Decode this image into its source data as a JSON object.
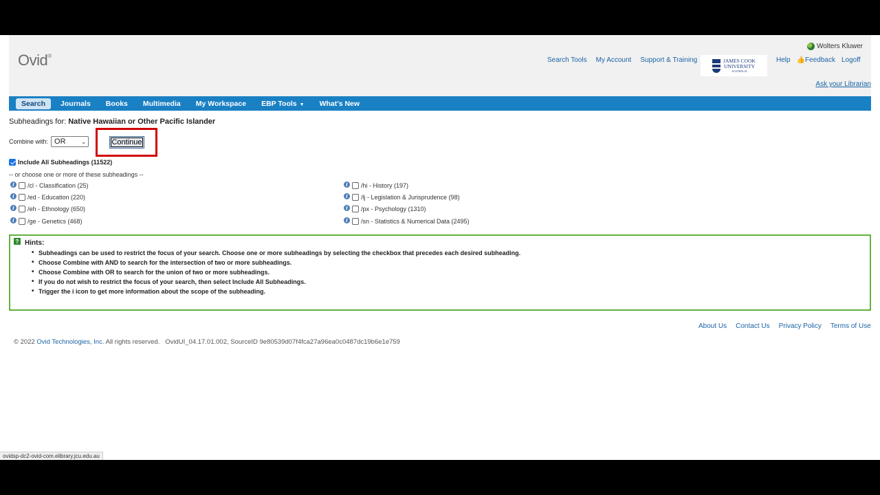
{
  "header": {
    "logo": "Ovid",
    "logo_mark": "®",
    "brand": "Wolters Kluwer",
    "top_links": [
      "Search Tools",
      "My Account",
      "Support & Training"
    ],
    "institution": {
      "line1": "JAMES COOK",
      "line2": "UNIVERSITY",
      "line3": "AUSTRALIA"
    },
    "right_links": [
      "Help",
      "Feedback",
      "Logoff"
    ],
    "ask_librarian": "Ask your Librarian"
  },
  "nav": {
    "tabs": [
      "Search",
      "Journals",
      "Books",
      "Multimedia",
      "My Workspace",
      "EBP Tools",
      "What's New"
    ],
    "active": "Search"
  },
  "subheadings": {
    "title_prefix": "Subheadings for:",
    "title_term": "Native Hawaiian or Other Pacific Islander",
    "combine_label": "Combine with:",
    "combine_value": "OR",
    "continue_label": "Continue",
    "include_all_label": "Include All Subheadings (11522)",
    "or_choose": "-- or choose one or more of these subheadings --",
    "left": [
      "/cl - Classification (25)",
      "/ed - Education (220)",
      "/eh - Ethnology (650)",
      "/ge - Genetics (468)"
    ],
    "right": [
      "/hi - History (197)",
      "/lj - Legislation & Jurisprudence (98)",
      "/px - Psychology (1310)",
      "/sn - Statistics & Numerical Data (2495)"
    ]
  },
  "hints": {
    "title": "Hints",
    "items": [
      "Subheadings can be used to restrict the focus of your search. Choose one or more subheadings by selecting the checkbox that precedes each desired subheading.",
      "Choose Combine with AND to search for the intersection of two or more subheadings.",
      "Choose Combine with OR to search for the union of two or more subheadings.",
      "If you do not wish to restrict the focus of your search, then select Include All Subheadings.",
      "Trigger the i icon to get more information about the scope of the subheading."
    ]
  },
  "footer": {
    "links": [
      "About Us",
      "Contact Us",
      "Privacy Policy",
      "Terms of Use"
    ],
    "copyright_prefix": "© 2022",
    "copyright_company": "Ovid Technologies, Inc.",
    "copyright_suffix": "All rights reserved.   OvidUI_04.17.01.002, SourceID 9e80539d07f4fca27a96ea0c0487dc19b6e1e759"
  },
  "status_url": "ovidsp-dc2-ovid-com.elibrary.jcu.edu.au"
}
